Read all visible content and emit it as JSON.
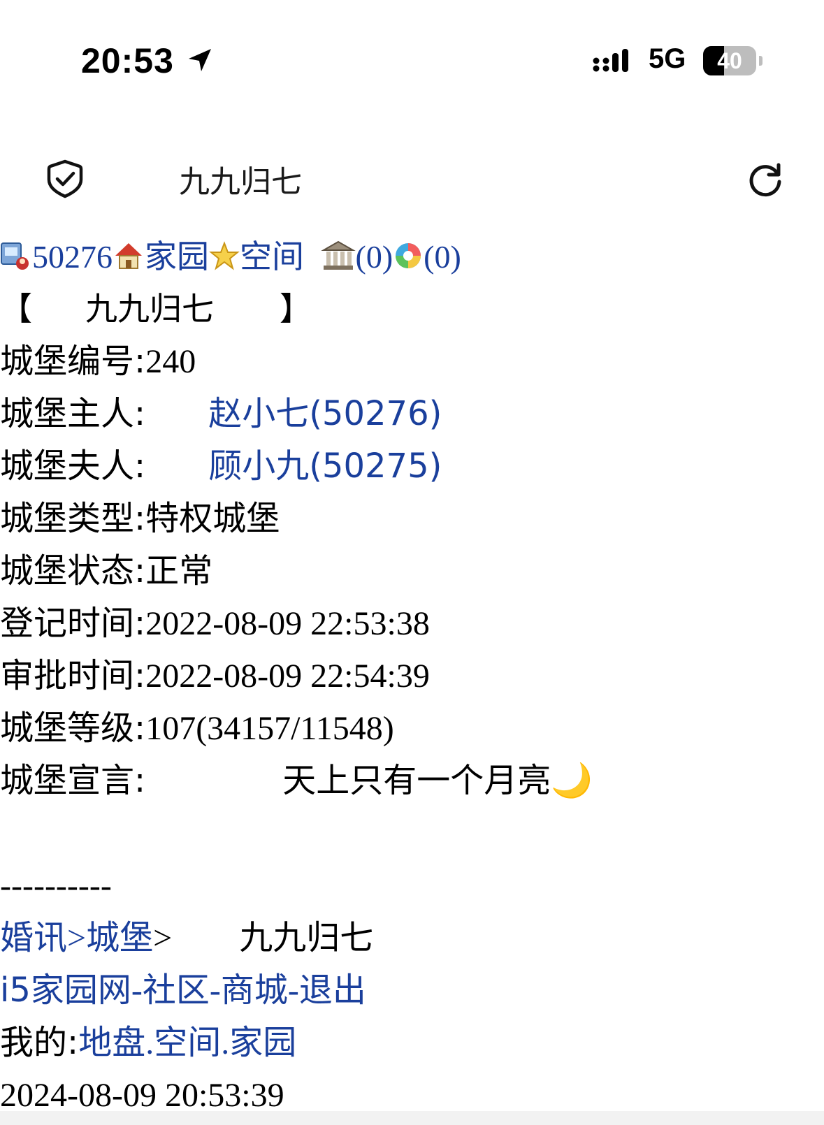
{
  "status_bar": {
    "time": "20:53",
    "network": "5G",
    "battery": "40",
    "battery_level": 0.4
  },
  "nav": {
    "title": "九九归七",
    "left_icon": "shield-check-icon",
    "right_icon": "refresh-icon"
  },
  "top_links": {
    "user_id": "50276",
    "home": "家园",
    "space": "空间",
    "bank_count": "(0)",
    "photo_count": "(0)"
  },
  "castle": {
    "bracket_open": "【",
    "name": "九九归七",
    "bracket_close": "】",
    "number_label": "城堡编号:",
    "number_value": "240",
    "owner_label": "城堡主人:",
    "owner_value": "赵小七(50276)",
    "lady_label": "城堡夫人:",
    "lady_value": "顾小九(50275)",
    "type_label": "城堡类型:",
    "type_value": "特权城堡",
    "status_label": "城堡状态:",
    "status_value": "正常",
    "reg_label": "登记时间:",
    "reg_value": "2022-08-09 22:53:38",
    "approve_label": "审批时间:",
    "approve_value": "2022-08-09 22:54:39",
    "level_label": "城堡等级:",
    "level_value": "107(34157/11548)",
    "motto_label": "城堡宣言:",
    "motto_value": "天上只有一个月亮🌙"
  },
  "footer": {
    "divider": "----------",
    "crumb_1": "婚讯",
    "sep_1": ">",
    "crumb_2": "城堡",
    "sep_2": ">",
    "crumb_current": "九九归七",
    "site": "i5家园网",
    "dash_1": "-",
    "community": "社区",
    "dash_2": "-",
    "mall": "商城",
    "dash_3": "-",
    "logout": "退出",
    "mine_label": "我的:",
    "my_land": "地盘",
    "dot_1": ".",
    "my_space": "空间",
    "dot_2": ".",
    "my_home": "家园",
    "timestamp": "2024-08-09 20:53:39"
  }
}
